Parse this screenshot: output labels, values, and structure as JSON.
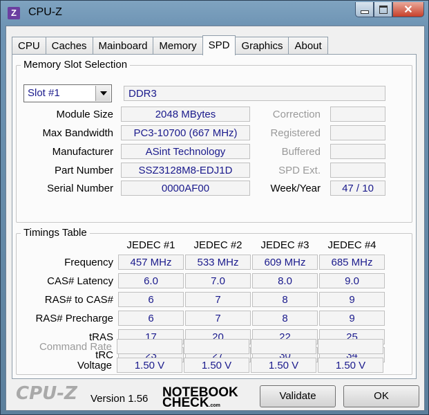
{
  "window": {
    "title": "CPU-Z",
    "app_icon_letter": "Z",
    "icon": "cpu-z-app-icon"
  },
  "tabs": [
    {
      "label": "CPU"
    },
    {
      "label": "Caches"
    },
    {
      "label": "Mainboard"
    },
    {
      "label": "Memory"
    },
    {
      "label": "SPD",
      "active": true
    },
    {
      "label": "Graphics"
    },
    {
      "label": "About"
    }
  ],
  "slot_section": {
    "title": "Memory Slot Selection",
    "slot_selected": "Slot #1",
    "memory_type": "DDR3",
    "fields": {
      "module_size": {
        "label": "Module Size",
        "value": "2048 MBytes"
      },
      "max_bandwidth": {
        "label": "Max Bandwidth",
        "value": "PC3-10700 (667 MHz)"
      },
      "manufacturer": {
        "label": "Manufacturer",
        "value": "ASint Technology"
      },
      "part_number": {
        "label": "Part Number",
        "value": "SSZ3128M8-EDJ1D"
      },
      "serial_number": {
        "label": "Serial Number",
        "value": "0000AF00"
      }
    },
    "right_fields": {
      "correction": {
        "label": "Correction",
        "value": ""
      },
      "registered": {
        "label": "Registered",
        "value": ""
      },
      "buffered": {
        "label": "Buffered",
        "value": ""
      },
      "spd_ext": {
        "label": "SPD Ext.",
        "value": ""
      },
      "week_year": {
        "label": "Week/Year",
        "value": "47 / 10"
      }
    }
  },
  "timings": {
    "title": "Timings Table",
    "columns": [
      "JEDEC #1",
      "JEDEC #2",
      "JEDEC #3",
      "JEDEC #4"
    ],
    "rows": [
      {
        "label": "Frequency",
        "values": [
          "457 MHz",
          "533 MHz",
          "609 MHz",
          "685 MHz"
        ]
      },
      {
        "label": "CAS# Latency",
        "values": [
          "6.0",
          "7.0",
          "8.0",
          "9.0"
        ]
      },
      {
        "label": "RAS# to CAS#",
        "values": [
          "6",
          "7",
          "8",
          "9"
        ]
      },
      {
        "label": "RAS# Precharge",
        "values": [
          "6",
          "7",
          "8",
          "9"
        ]
      },
      {
        "label": "tRAS",
        "values": [
          "17",
          "20",
          "22",
          "25"
        ]
      },
      {
        "label": "tRC",
        "values": [
          "23",
          "27",
          "30",
          "34"
        ]
      },
      {
        "label": "Command Rate",
        "values": [
          "",
          "",
          "",
          ""
        ],
        "disabled": true
      },
      {
        "label": "Voltage",
        "values": [
          "1.50 V",
          "1.50 V",
          "1.50 V",
          "1.50 V"
        ]
      }
    ]
  },
  "footer": {
    "logo": "CPU-Z",
    "version": "Version 1.56",
    "watermark_line1": "NOTEBOOK",
    "watermark_line2": "CHECK",
    "watermark_suffix": ".com",
    "validate_label": "Validate",
    "ok_label": "OK"
  }
}
